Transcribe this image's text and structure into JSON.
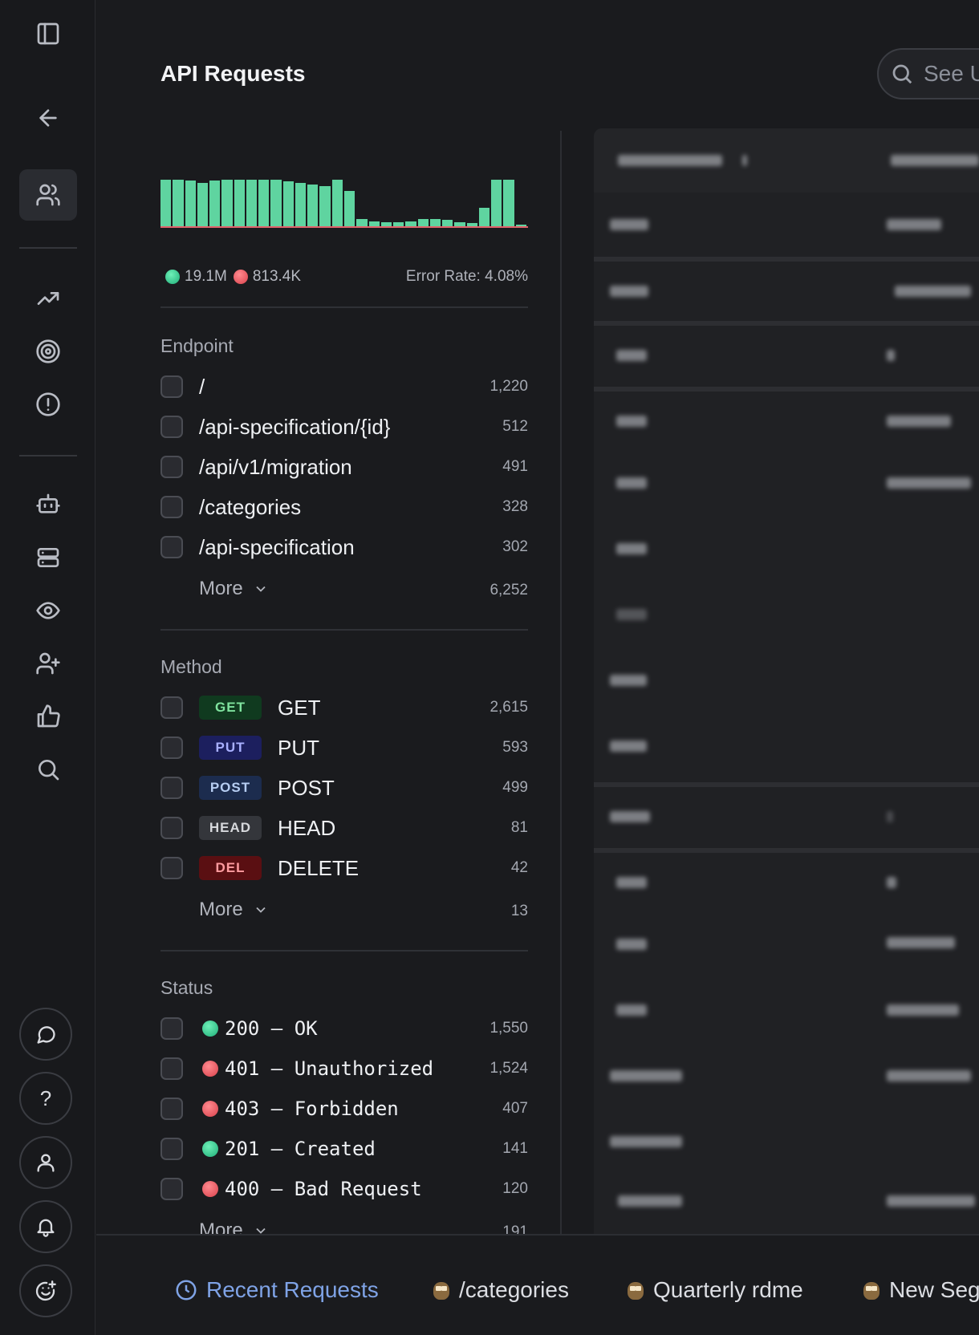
{
  "header": {
    "title": "API Requests",
    "search_placeholder": "See U"
  },
  "summary": {
    "success_count": "19.1M",
    "error_count": "813.4K",
    "error_rate": "Error Rate: 4.08%"
  },
  "histogram": {
    "success_values": [
      1.0,
      1.0,
      0.98,
      0.94,
      0.98,
      1.0,
      1.0,
      1.0,
      1.0,
      1.0,
      0.96,
      0.94,
      0.9,
      0.86,
      1.0,
      0.76,
      0.18,
      0.14,
      0.12,
      0.12,
      0.14,
      0.18,
      0.18,
      0.16,
      0.12,
      0.1,
      0.42,
      1.0,
      1.0,
      0.06
    ]
  },
  "endpoint": {
    "title": "Endpoint",
    "items": [
      {
        "label": "/",
        "count": "1,220"
      },
      {
        "label": "/api-specification/{id}",
        "count": "512"
      },
      {
        "label": "/api/v1/migration",
        "count": "491"
      },
      {
        "label": "/categories",
        "count": "328"
      },
      {
        "label": "/api-specification",
        "count": "302"
      }
    ],
    "more_label": "More",
    "more_count": "6,252"
  },
  "method": {
    "title": "Method",
    "items": [
      {
        "badge": "GET",
        "label": "GET",
        "count": "2,615"
      },
      {
        "badge": "PUT",
        "label": "PUT",
        "count": "593"
      },
      {
        "badge": "POST",
        "label": "POST",
        "count": "499"
      },
      {
        "badge": "HEAD",
        "label": "HEAD",
        "count": "81"
      },
      {
        "badge": "DEL",
        "label": "DELETE",
        "count": "42"
      }
    ],
    "more_label": "More",
    "more_count": "13"
  },
  "status": {
    "title": "Status",
    "items": [
      {
        "label": "200 – OK",
        "count": "1,550",
        "color": "green"
      },
      {
        "label": "401 – Unauthorized",
        "count": "1,524",
        "color": "red"
      },
      {
        "label": "403 – Forbidden",
        "count": "407",
        "color": "red"
      },
      {
        "label": "201 – Created",
        "count": "141",
        "color": "green"
      },
      {
        "label": "400 – Bad Request",
        "count": "120",
        "color": "red"
      }
    ],
    "more_label": "More",
    "more_count": "191"
  },
  "bottom_tabs": [
    {
      "label": "Recent Requests",
      "icon": "clock-icon"
    },
    {
      "label": "/categories",
      "icon": "owl-icon"
    },
    {
      "label": "Quarterly rdme",
      "icon": "owl-icon"
    },
    {
      "label": "New Seg",
      "icon": "owl-icon"
    }
  ],
  "colors": {
    "success": "#5fd4a0",
    "error": "#e0626b",
    "accent": "#7fa3e6",
    "background": "#1a1b1e"
  }
}
